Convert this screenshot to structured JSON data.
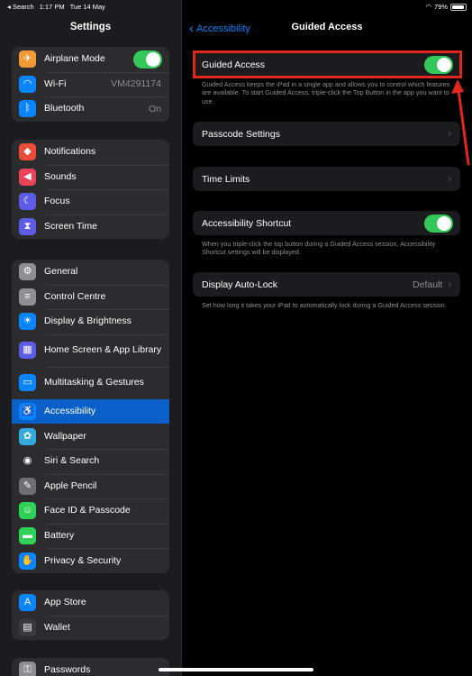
{
  "status_bar": {
    "back_app": "◂ Search",
    "time": "1:17 PM",
    "date": "Tue 14 May",
    "battery": "79%",
    "battery_level": 0.79
  },
  "sidebar": {
    "title": "Settings",
    "groups": [
      {
        "items": [
          {
            "label": "Airplane Mode",
            "icon": "airplane-icon",
            "color": "#f09a37",
            "toggle": true
          },
          {
            "label": "Wi-Fi",
            "icon": "wifi-icon",
            "color": "#0a84ff",
            "value": "VM4291174"
          },
          {
            "label": "Bluetooth",
            "icon": "bluetooth-icon",
            "color": "#0a84ff",
            "value": "On"
          }
        ]
      },
      {
        "items": [
          {
            "label": "Notifications",
            "icon": "bell-icon",
            "color": "#eb4d3d"
          },
          {
            "label": "Sounds",
            "icon": "speaker-icon",
            "color": "#eb445a"
          },
          {
            "label": "Focus",
            "icon": "moon-icon",
            "color": "#5e5ce6"
          },
          {
            "label": "Screen Time",
            "icon": "hourglass-icon",
            "color": "#5e5ce6"
          }
        ]
      },
      {
        "items": [
          {
            "label": "General",
            "icon": "gear-icon",
            "color": "#8e8e93"
          },
          {
            "label": "Control Centre",
            "icon": "switches-icon",
            "color": "#8e8e93"
          },
          {
            "label": "Display & Brightness",
            "icon": "sun-icon",
            "color": "#0a84ff"
          },
          {
            "label": "Home Screen & App Library",
            "icon": "grid-icon",
            "color": "#5e5ce6"
          },
          {
            "label": "Multitasking & Gestures",
            "icon": "multitask-icon",
            "color": "#0a84ff"
          },
          {
            "label": "Accessibility",
            "icon": "accessibility-icon",
            "color": "#0a84ff",
            "active": true
          },
          {
            "label": "Wallpaper",
            "icon": "flower-icon",
            "color": "#34aadc"
          },
          {
            "label": "Siri & Search",
            "icon": "siri-icon",
            "color": "#2c2c2e"
          },
          {
            "label": "Apple Pencil",
            "icon": "pencil-icon",
            "color": "#6e6e73"
          },
          {
            "label": "Face ID & Passcode",
            "icon": "face-id-icon",
            "color": "#30d158"
          },
          {
            "label": "Battery",
            "icon": "battery-icon",
            "color": "#30d158"
          },
          {
            "label": "Privacy & Security",
            "icon": "hand-icon",
            "color": "#0a84ff"
          }
        ]
      },
      {
        "items": [
          {
            "label": "App Store",
            "icon": "app-store-icon",
            "color": "#0a84ff"
          },
          {
            "label": "Wallet",
            "icon": "wallet-icon",
            "color": "#3a3a3c"
          }
        ]
      },
      {
        "items": [
          {
            "label": "Passwords",
            "icon": "key-icon",
            "color": "#8e8e93"
          }
        ]
      }
    ]
  },
  "detail": {
    "back_label": "Accessibility",
    "title": "Guided Access",
    "guided_access": {
      "label": "Guided Access",
      "on": true,
      "footnote": "Guided Access keeps the iPad in a single app and allows you to control which features are available. To start Guided Access, triple-click the Top Button in the app you want to use."
    },
    "passcode_settings": {
      "label": "Passcode Settings"
    },
    "time_limits": {
      "label": "Time Limits"
    },
    "accessibility_shortcut": {
      "label": "Accessibility Shortcut",
      "on": true,
      "footnote": "When you triple-click the top button during a Guided Access session, Accessibility Shortcut settings will be displayed."
    },
    "auto_lock": {
      "label": "Display Auto-Lock",
      "value": "Default",
      "footnote": "Set how long it takes your iPad to automatically lock during a Guided Access session."
    }
  },
  "annotation": {
    "color": "#e1261c"
  }
}
